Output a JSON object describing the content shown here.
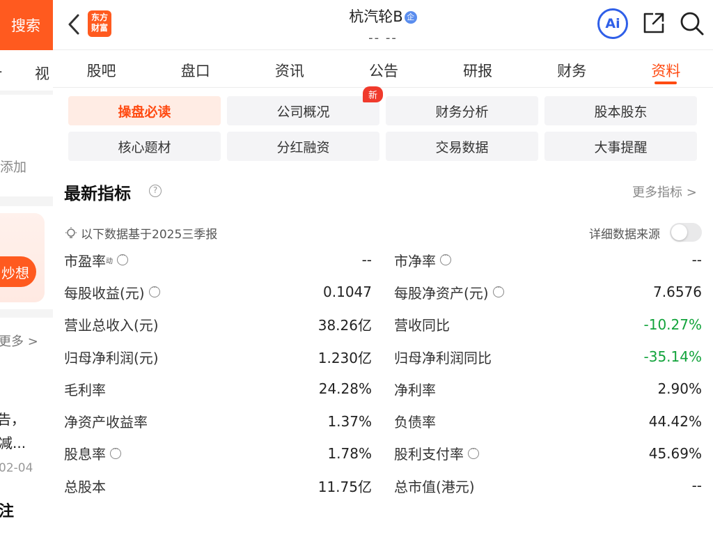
{
  "left_panel": {
    "search_label": "搜索",
    "tab_cut": "-",
    "tab_video": "视",
    "add_text": "添加",
    "pill_text": "炒想",
    "more_text": "更多 >",
    "news_line1": "告，",
    "news_line2": "减...",
    "news_date": "02-04",
    "follow_text": "注"
  },
  "header": {
    "logo_text": "东方财富",
    "title": "杭汽轮B",
    "title_badge": "企",
    "subtitle": "-- --",
    "ai_label": "Ai"
  },
  "tabs": [
    {
      "label": "股吧"
    },
    {
      "label": "盘口"
    },
    {
      "label": "资讯"
    },
    {
      "label": "公告"
    },
    {
      "label": "研报"
    },
    {
      "label": "财务"
    },
    {
      "label": "资料"
    }
  ],
  "subnav": [
    {
      "label": "操盘必读"
    },
    {
      "label": "公司概况"
    },
    {
      "label": "财务分析"
    },
    {
      "label": "股本股东"
    },
    {
      "label": "核心题材"
    },
    {
      "label": "分红融资"
    },
    {
      "label": "交易数据"
    },
    {
      "label": "大事提醒"
    }
  ],
  "subnav_badge": "新",
  "section": {
    "title": "最新指标",
    "help": "?",
    "more": "更多指标 >",
    "note": "以下数据基于2025三季报",
    "source_label": "详细数据来源"
  },
  "metrics_left": [
    {
      "label": "市盈率",
      "sup": "动",
      "value": "--"
    },
    {
      "label": "每股收益(元)",
      "value": "0.1047"
    },
    {
      "label": "营业总收入(元)",
      "value": "38.26亿"
    },
    {
      "label": "归母净利润(元)",
      "value": "1.230亿"
    },
    {
      "label": "毛利率",
      "value": "24.28%"
    },
    {
      "label": "净资产收益率",
      "value": "1.37%"
    },
    {
      "label": "股息率",
      "value": "1.78%"
    },
    {
      "label": "总股本",
      "value": "11.75亿"
    }
  ],
  "metrics_right": [
    {
      "label": "市净率",
      "value": "--"
    },
    {
      "label": "每股净资产(元)",
      "value": "7.6576"
    },
    {
      "label": "营收同比",
      "value": "-10.27%"
    },
    {
      "label": "归母净利润同比",
      "value": "-35.14%"
    },
    {
      "label": "净利率",
      "value": "2.90%"
    },
    {
      "label": "负债率",
      "value": "44.42%"
    },
    {
      "label": "股利支付率",
      "value": "45.69%"
    },
    {
      "label": "总市值(港元)",
      "value": "--"
    }
  ],
  "colors": {
    "accent": "#ff4b12",
    "negative": "#12a33b",
    "ai_blue": "#2f5fe8"
  }
}
